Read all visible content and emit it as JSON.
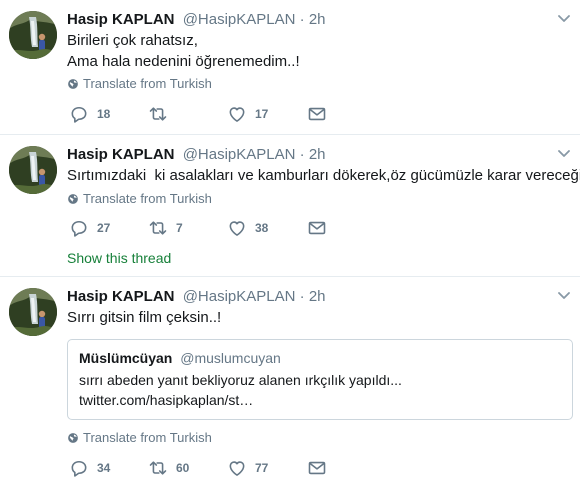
{
  "tweets": [
    {
      "name": "Hasip KAPLAN",
      "handle": "@HasipKAPLAN",
      "dot": "·",
      "time": "2h",
      "lines": [
        "Birileri çok rahatsız,",
        "Ama hala nedenini öğrenemedim..!"
      ],
      "translate": "Translate from Turkish",
      "replies": "18",
      "retweets": "",
      "likes": "17"
    },
    {
      "name": "Hasip KAPLAN",
      "handle": "@HasipKAPLAN",
      "dot": "·",
      "time": "2h",
      "lines": [
        "Sırtımızdaki  ki asalakları ve kamburları dökerek,öz gücümüzle karar vereceğiz..!"
      ],
      "translate": "Translate from Turkish",
      "replies": "27",
      "retweets": "7",
      "likes": "38",
      "show_thread": "Show this thread"
    },
    {
      "name": "Hasip KAPLAN",
      "handle": "@HasipKAPLAN",
      "dot": "·",
      "time": "2h",
      "lines": [
        "Sırrı gitsin film çeksin..!"
      ],
      "quote": {
        "name": "Müslümcüyan",
        "handle": "@muslumcuyan",
        "text": "sırrı abeden yanıt bekliyoruz alanen ırkçılık yapıldı...",
        "link": "twitter.com/hasipkaplan/st…"
      },
      "translate": "Translate from Turkish",
      "replies": "34",
      "retweets": "60",
      "likes": "77"
    }
  ],
  "icons": {
    "reply": "reply-icon",
    "retweet": "retweet-icon",
    "like": "heart-icon",
    "dm": "envelope-icon",
    "globe": "globe-icon",
    "caret": "chevron-down-icon"
  },
  "colors": {
    "text": "#14171a",
    "muted": "#657786",
    "border": "#e6ecf0",
    "thread_link": "#17803a"
  }
}
